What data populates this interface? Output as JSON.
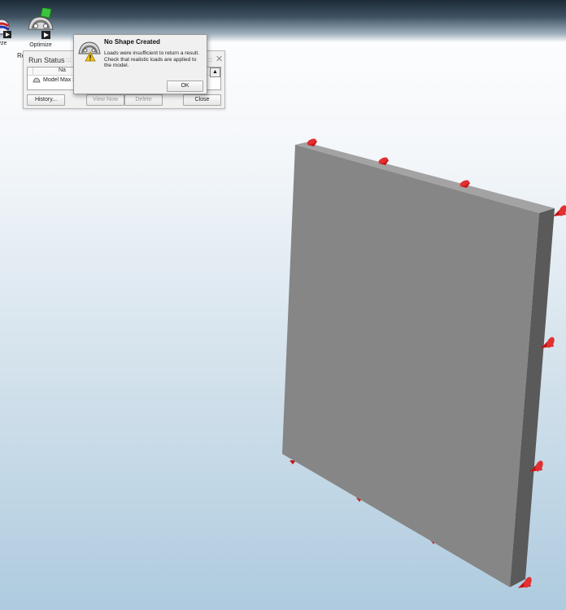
{
  "toolbar": {
    "analyze_label": "yze",
    "optimize_label": "Optimize",
    "cut_label": "Re"
  },
  "run_status": {
    "title": "Run Status",
    "column_name": "Na",
    "rows": [
      {
        "name": "Model Max S"
      }
    ],
    "buttons": {
      "history": "History...",
      "view_now": "View Now",
      "delete": "Delete",
      "close": "Close"
    }
  },
  "dialog": {
    "title": "No Shape Created",
    "message": "Loads were insufficient to return a result. Check that realistic loads are applied to the model.",
    "ok_label": "OK"
  },
  "colors": {
    "plate_front": "#868686",
    "plate_side": "#5a5a5a",
    "support_red": "#c81414",
    "accent_green": "#3bc43b"
  },
  "icons": {
    "optimize": "optimize-icon",
    "analyze": "analyze-icon",
    "dialog": "warning-icon"
  }
}
